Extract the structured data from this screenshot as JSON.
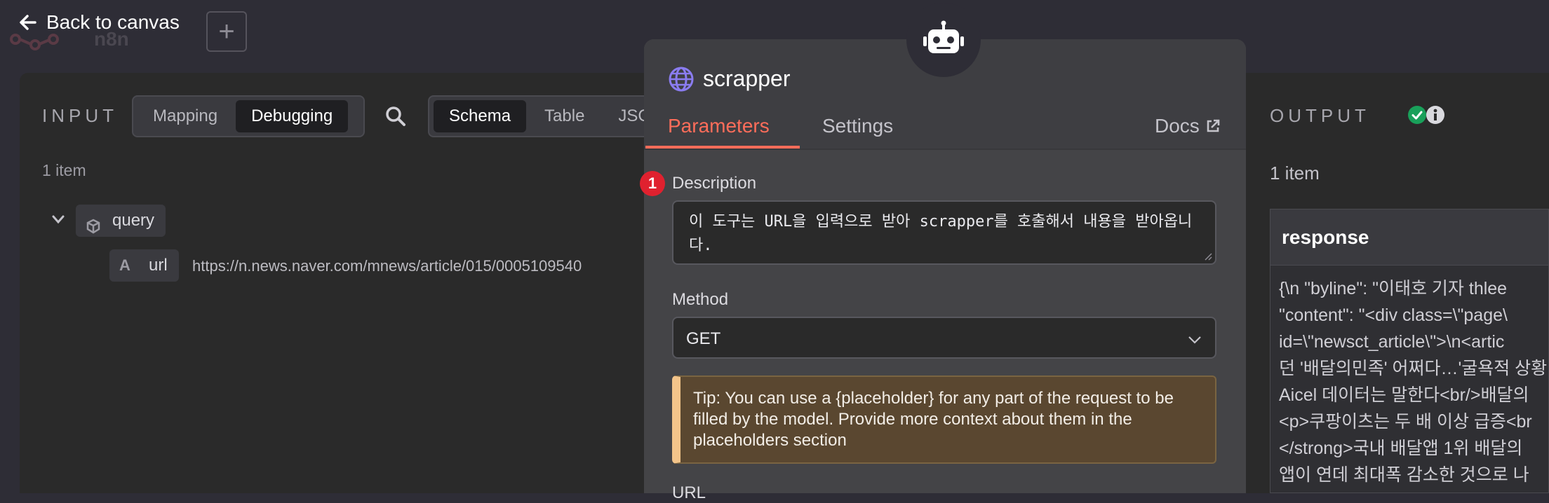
{
  "topbar": {
    "back_label": "Back to canvas",
    "logo_text": "n8n",
    "add_label": "+"
  },
  "input": {
    "title": "INPUT",
    "mode_tabs": [
      "Mapping",
      "Debugging"
    ],
    "view_tabs": [
      "Schema",
      "Table",
      "JSC"
    ],
    "item_count": "1 item",
    "tree": {
      "root_label": "query",
      "field_type": "A",
      "field_name": "url",
      "field_value": "https://n.news.naver.com/mnews/article/015/0005109540"
    }
  },
  "node": {
    "name": "scrapper",
    "tabs": [
      "Parameters",
      "Settings"
    ],
    "docs_label": "Docs",
    "issue_count": "1",
    "description_label": "Description",
    "description_value": "이 도구는 URL을 입력으로 받아 scrapper를 호출해서 내용을 받아옵니다.",
    "method_label": "Method",
    "method_value": "GET",
    "tip": "Tip: You can use a {placeholder} for any part of the request to be filled by the model. Provide more context about them in the placeholders section",
    "url_label": "URL"
  },
  "output": {
    "title": "OUTPUT",
    "item_count": "1 item",
    "column_header": "response",
    "response_lines": [
      "{\\n  \"byline\": \"이태호 기자 thlee",
      "\"content\": \"<div class=\\\"page\\",
      "id=\\\"newsct_article\\\">\\n<artic",
      "던 '배달의민족' 어쩌다…'굴욕적 상황",
      "Aicel 데이터는 말한다<br/>배달의",
      "<p>쿠팡이츠는 두 배 이상 급증<br",
      "</strong>국내 배달앱 1위 배달의",
      "앱이 연데 최대폭 감소한 것으로 나"
    ]
  },
  "colors": {
    "accent": "#ff6d5a",
    "success": "#19a05a",
    "badge": "#e0212f",
    "tip_border": "#f3c48a"
  }
}
